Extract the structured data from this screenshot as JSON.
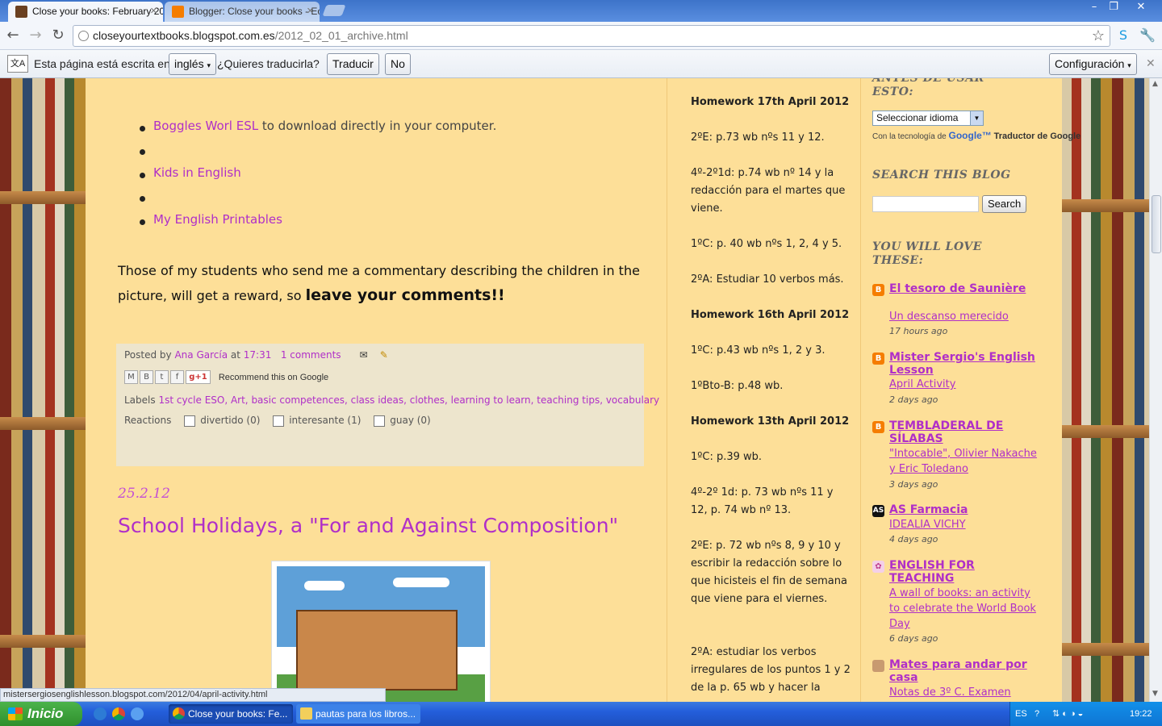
{
  "browser": {
    "tabs": [
      {
        "title": "Close your books: February 20",
        "active": true
      },
      {
        "title": "Blogger: Close your books - Ec",
        "active": false
      }
    ],
    "url_domain": "closeyourtextbooks.blogspot.com.es",
    "url_path": "/2012_02_01_archive.html",
    "status_url": "mistersergiosenglishlesson.blogspot.com/2012/04/april-activity.html"
  },
  "translate_bar": {
    "prefix": "Esta página está escrita en",
    "language": "inglés",
    "question": "¿Quieres traducirla?",
    "translate": "Traducir",
    "no": "No",
    "options": "Configuración"
  },
  "post": {
    "links": [
      "Boggles Worl ESL",
      "Kids in English",
      "My English Printables"
    ],
    "link_suffix": " to download directly in your computer.",
    "paragraph": "Those of my students who send me a commentary describing the children in the picture, will get a reward, so ",
    "paragraph_emphasis": "leave your comments!!",
    "posted_by_label": "Posted by",
    "author": "Ana García",
    "at": "at",
    "time": "17:31",
    "comments": "1 comments",
    "recommend": "Recommend this on Google",
    "labels_label": "Labels",
    "labels": "1st cycle ESO, Art, basic competences, class ideas, clothes, learning to learn, teaching tips, vocabulary",
    "reactions_label": "Reactions",
    "reactions": [
      {
        "label": "divertido (0)"
      },
      {
        "label": "interesante (1)"
      },
      {
        "label": "guay (0)"
      }
    ]
  },
  "next_post": {
    "date": "25.2.12",
    "title": "School Holidays, a \"For and Against Composition\""
  },
  "homework": [
    {
      "text": "Homework 17th April 2012",
      "heading": true
    },
    {
      "text": "2ºE: p.73 wb nºs 11 y 12.",
      "heading": false
    },
    {
      "text": "4º-2º1d: p.74 wb nº 14 y la redacción para el martes que viene.",
      "heading": false
    },
    {
      "text": "1ºC: p. 40 wb nºs 1, 2, 4 y 5.",
      "heading": false
    },
    {
      "text": "2ºA: Estudiar 10 verbos más.",
      "heading": false
    },
    {
      "text": "Homework 16th April 2012",
      "heading": true
    },
    {
      "text": "1ºC: p.43 wb nºs 1, 2 y 3.",
      "heading": false
    },
    {
      "text": "1ºBto-B: p.48 wb.",
      "heading": false
    },
    {
      "text": "Homework 13th April 2012",
      "heading": true
    },
    {
      "text": "1ºC: p.39 wb.",
      "heading": false
    },
    {
      "text": "4º-2º 1d: p. 73 wb nºs 11 y 12, p. 74 wb nº 13.",
      "heading": false
    },
    {
      "text": "2ºE: p. 72 wb nºs 8, 9 y 10 y escribir la redacción sobre lo que hicisteis el fin de semana que viene para el viernes.",
      "heading": false
    },
    {
      "text": "2ºA: estudiar los verbos irregulares de los puntos 1 y 2 de la p. 65 wb y hacer la",
      "heading": false
    }
  ],
  "sidebar": {
    "top_heading": "ANTES DE USAR ESTO:",
    "language_select": "Seleccionar idioma",
    "powered_by": "Con la tecnología de",
    "google": "Google™",
    "translator": "Traductor de Google",
    "search_heading": "SEARCH THIS BLOG",
    "search_button": "Search",
    "love_heading": "YOU WILL LOVE THESE:",
    "blogs": [
      {
        "name": "El tesoro de Saunière",
        "post": "Un descanso merecido",
        "age": "17 hours ago",
        "icon": "blogger-icon"
      },
      {
        "name": "Mister Sergio's English Lesson",
        "post": "April Activity",
        "age": "2 days ago",
        "icon": "blogger-icon"
      },
      {
        "name": "TEMBLADERAL DE SÍLABAS",
        "post": "\"Intocable\", Olivier Nakache y Eric Toledano",
        "age": "3 days ago",
        "icon": "blogger-icon"
      },
      {
        "name": "AS Farmacia",
        "post": "IDEALIA VICHY",
        "age": "4 days ago",
        "icon": "as-icon"
      },
      {
        "name": "ENGLISH FOR TEACHING",
        "post": "A wall of books: an activity to celebrate the World Book Day",
        "age": "6 days ago",
        "icon": "flower-icon"
      },
      {
        "name": "Mates para andar por casa",
        "post": "Notas de 3º C. Examen",
        "age": "",
        "icon": "avatar-icon"
      }
    ]
  },
  "taskbar": {
    "start": "Inicio",
    "items": [
      "Close your books: Fe...",
      "pautas para los libros..."
    ],
    "lang": "ES",
    "clock": "19:22"
  }
}
